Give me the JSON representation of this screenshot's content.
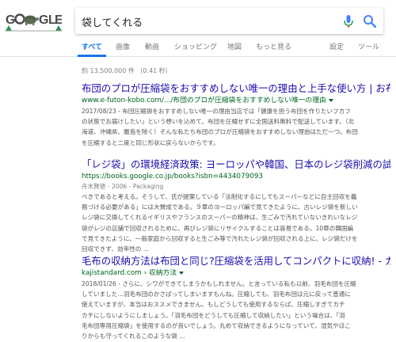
{
  "colors": {
    "link": "#1a0dab",
    "url": "#006621",
    "accent": "#1a73e8",
    "snippet": "#545454",
    "muted": "#808080"
  },
  "logo": {
    "text": "GOOGLE",
    "letters": [
      "G",
      "O",
      "O",
      "G",
      "L",
      "E"
    ],
    "icon": "google-doodle-logo"
  },
  "search": {
    "query": "袋してくれる",
    "mic_icon": "mic-icon",
    "search_icon": "search-icon"
  },
  "tabs": [
    {
      "label": "すべて",
      "active": true
    },
    {
      "label": "画像"
    },
    {
      "label": "動画"
    },
    {
      "label": "ショッピング"
    },
    {
      "label": "地図"
    },
    {
      "label": "もっと見る"
    },
    {
      "label": "設定"
    },
    {
      "label": "ツール"
    }
  ],
  "stats": "約 13,500,000 件 （0.41 秒）",
  "results": [
    {
      "title": "布団のプロが圧縮袋をおすすめしない唯一の理由と上手な使い方 | お布...",
      "url": "www.e-futon-kobo.com/.../布団のプロが圧縮袋をおすすめしない唯一の理由",
      "meta": "",
      "snippet": [
        "2017/08/23 - 布団圧縮袋をおすすめしない唯一の理由当店では「健康を担う布団を作りたいフカフ",
        "の状態でお届けしたい」という想いを込めて、布団を圧縮せずに全国送料無料で配送しています。（北",
        "海道、沖縄県、離島を除く）そんな私たち布団のプロが圧縮袋をおすすめしない理由はただ一つ。布団",
        "を圧縮すると二度と同じ形状に戻らないからです。"
      ]
    },
    {
      "title": "「レジ袋」の環境経済政策: ヨーロッパや韓国、日本のレジ袋削減の試み",
      "url": "https://books.google.co.jp/books?isbn=4434079093",
      "meta": "舟木賢徳 - 2006 - Packaging",
      "snippet": [
        "べきであると考える。そうして、氏が提案している「法制化するにしてもスーパーなどに自主回収を義",
        "務づける必要がある」には大賛成である。９章のヨーロッパ編で見てきたように、古いレジ袋を新しい",
        "レジ袋に交換してくれるイギリスやフランスのスーパーの精神は、生ごみで汚れていないきれいなレジ",
        "袋がレジの店舗で回収されるために、再びレジ袋にリサイクルすることは容易である。10章の韓国編",
        "で見てきたように、一般家庭から回収すると生ごみ等で汚れたレジ袋が回収される上に、レジ袋だけを",
        "回収できず、効率性の ..."
      ]
    },
    {
      "title": "毛布の収納方法は布団と同じ?圧縮袋を活用してコンパクトに収納! - カ...",
      "url": "kajistandard.com › 収納方法",
      "meta": "",
      "snippet": [
        "2018/01/26 - さらに、シワができてしまうかもしれません。と言っている私も以前、羽毛布団を圧縮",
        "していました…羽毛布団のかさばってしまいますもんね。圧縮しても、羽毛布団は元に戻って普通に",
        "使えていますが、本当はおススメできません。もしどうしても使用するならば、圧縮しすぎてカチ",
        "カチにしないようにしましょう。「羽毛布団をどうしても圧縮して収納したい」という場合は、「羽",
        "毛布団専用圧縮袋」を使用するのが良いでしょう。丸めて収納できるようになっていて、湿気やほこ",
        "りからも守ってくれるこのような袋 ..."
      ]
    }
  ]
}
